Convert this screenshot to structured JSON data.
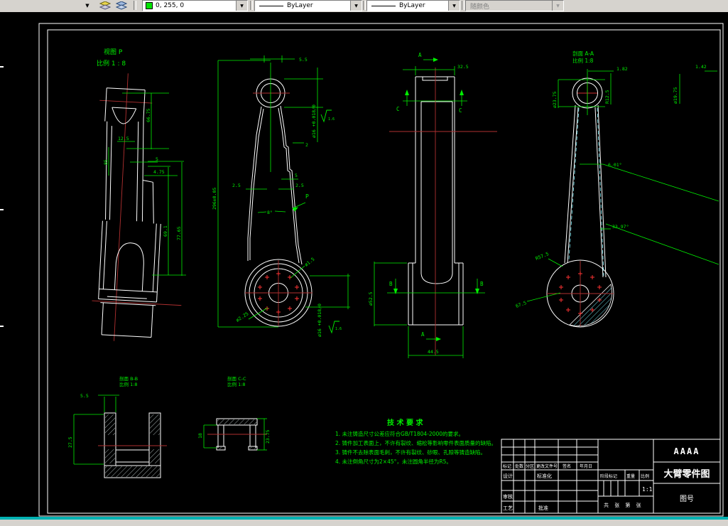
{
  "toolbar": {
    "color_combo": {
      "value": "0, 255, 0",
      "swatch_color": "#00e400"
    },
    "linetype_combo": {
      "value": "ByLayer"
    },
    "linetype_combo2": {
      "value": "ByLayer"
    },
    "lineweight_combo": {
      "value": "随颜色"
    },
    "drop_glyph": "▼"
  },
  "view_p": {
    "title": "视图 P",
    "scale": "比例 1 : 8",
    "dim_66_75": "66.75",
    "dim_12_5": "12.5",
    "dim_85": "85",
    "dim_5": "5",
    "dim_4_75": "4.75",
    "dim_69_1": "69.1",
    "dim_77_65": "77.65"
  },
  "front_view": {
    "dim_5_5": "5.5",
    "dim_296": "296±0.05",
    "dim_2": "2",
    "dim_5": "5",
    "dim_2_5_l": "2.5",
    "dim_2_5_r": "2.5",
    "dim_8deg": "8°",
    "view_arrow": "P",
    "bore_dim": "ø16 +0.018/0",
    "rough": "1.6",
    "hole_small": "ø1.5",
    "hole_large": "ø2.25"
  },
  "side_view": {
    "sec_a": "A",
    "sec_b": "B",
    "sec_c": "C",
    "dim_32_5": "32.5",
    "dim_52_5": "ø52.5",
    "dim_44_5": "44.5"
  },
  "section_aa": {
    "title": "剖面 A-A",
    "scale": "比例 1:8",
    "dim_1_82": "1.82",
    "dim_r12_5": "R12.5",
    "dim_23_75": "ø23.75",
    "dim_1_42": "1.42",
    "dim_19_75": "ø19.75",
    "ang_6_01": "6.01°",
    "ang_33_97": "33.97°",
    "dim_r57_5": "R57.5",
    "dim_67_5": "67.5"
  },
  "section_bb": {
    "title": "剖面 B-B",
    "scale": "比例 1:8",
    "dim_5_5": "5.5",
    "dim_27_5": "27.5"
  },
  "section_cc": {
    "title": "剖面 C-C",
    "scale": "比例 1:8",
    "dim_18": "18",
    "dim_23_75": "23.75"
  },
  "tech_req": {
    "title": "技 术 要 求",
    "item1": "1. 未注铸造尺寸公差应符合GB/T1804-2000的要求。",
    "item2": "2. 铸件加工表面上，不许有裂纹、缩松等影响零件表面质量的缺陷。",
    "item3": "3. 铸件不去除表面毛刺，不许有裂纹、砂眼、孔隙等铸造缺陷。",
    "item4": "4. 未注倒角尺寸为2×45°，未注圆角半径为R5。"
  },
  "title_block": {
    "company": "AAAA",
    "drawing_title": "大臂零件图",
    "drawing_no": "图号",
    "scale_value": "1:1",
    "h_mark": "标记",
    "h_count": "处数",
    "h_zone": "分区",
    "h_file": "更改文件号",
    "h_sign": "签名",
    "h_date": "年月日",
    "design": "设计",
    "standard": "标准化",
    "check": "审核",
    "process": "工艺",
    "approve": "批准",
    "stage": "阶段标记",
    "weight": "重量",
    "scale_label": "比例",
    "sheet": "共 张 第 张"
  }
}
